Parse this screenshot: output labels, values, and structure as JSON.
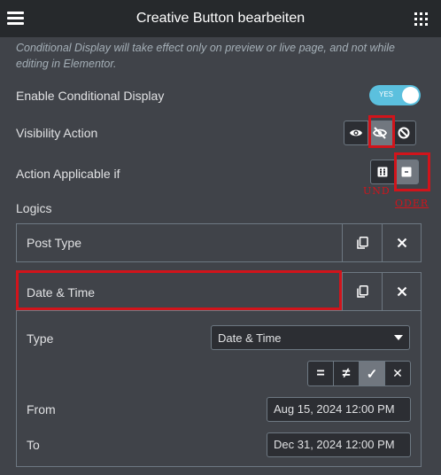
{
  "header": {
    "title": "Creative Button bearbeiten"
  },
  "note": "Conditional Display will take effect only on preview or live page, and not while editing in Elementor.",
  "enable_display": {
    "label": "Enable Conditional Display",
    "toggle_text": "YES",
    "enabled": true
  },
  "visibility": {
    "label": "Visibility Action",
    "options": [
      "show-icon",
      "hide-icon",
      "ban-icon"
    ],
    "selected": "hide-icon"
  },
  "applicable": {
    "label": "Action Applicable if",
    "options": [
      "all-icon",
      "any-icon"
    ],
    "selected": "any-icon",
    "annotation_and": "UND",
    "annotation_or": "ODER"
  },
  "logics": {
    "title": "Logics",
    "items": [
      {
        "label": "Post Type"
      },
      {
        "label": "Date & Time"
      }
    ]
  },
  "detail": {
    "type_label": "Type",
    "type_value": "Date & Time",
    "operators": [
      "=",
      "≠",
      "✓",
      "✕"
    ],
    "selected_operator": "✓",
    "from_label": "From",
    "from_value": "Aug 15, 2024 12:00 PM",
    "to_label": "To",
    "to_value": "Dec 31, 2024 12:00 PM"
  },
  "colors": {
    "accent": "#5bc0de",
    "annotation_red": "#d1141b",
    "header_bg": "#26292c",
    "panel_bg": "#404349"
  }
}
